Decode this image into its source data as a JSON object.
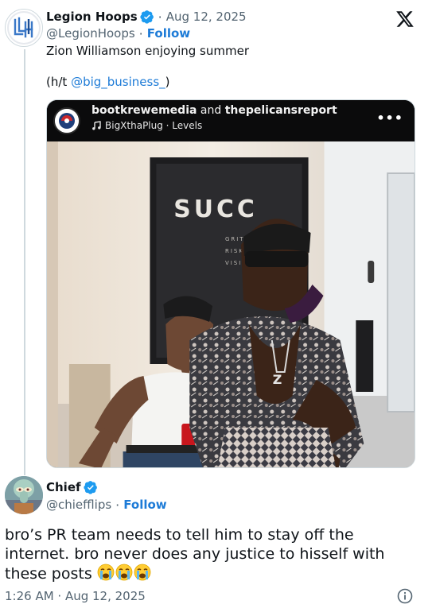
{
  "colors": {
    "accent": "#1d7bd7",
    "text": "#0f1419",
    "muted": "#536471",
    "verified": "#1d9bf0",
    "border": "#cfd9de"
  },
  "parent_tweet": {
    "author_name": "Legion Hoops",
    "author_handle": "@LegionHoops",
    "avatar_icon": "legion-hoops-logo",
    "date": "Aug 12, 2025",
    "follow_label": "Follow",
    "text": "Zion Williamson enjoying summer",
    "credit_prefix": "(h/t ",
    "credit_mention": "@big_business_",
    "credit_suffix": ")",
    "media": {
      "users_1": "bootkrewemedia",
      "users_and": " and ",
      "users_2": "thepelicansreport",
      "audio": "BigXthaPlug · Levels",
      "more_icon": "more-dots-icon",
      "poster_text": "SUCC",
      "poster_words": [
        "GRIT",
        "RISK",
        "VISI"
      ]
    }
  },
  "reply_tweet": {
    "author_name": "Chief",
    "author_handle": "@chiefflips",
    "follow_label": "Follow",
    "text": "bro’s PR team needs to tell him to stay off the internet. bro never does any justice to hisself with these posts ",
    "emojis": [
      "loudly-crying-face",
      "loudly-crying-face",
      "loudly-crying-face"
    ],
    "time": "1:26 AM · Aug 12, 2025"
  }
}
